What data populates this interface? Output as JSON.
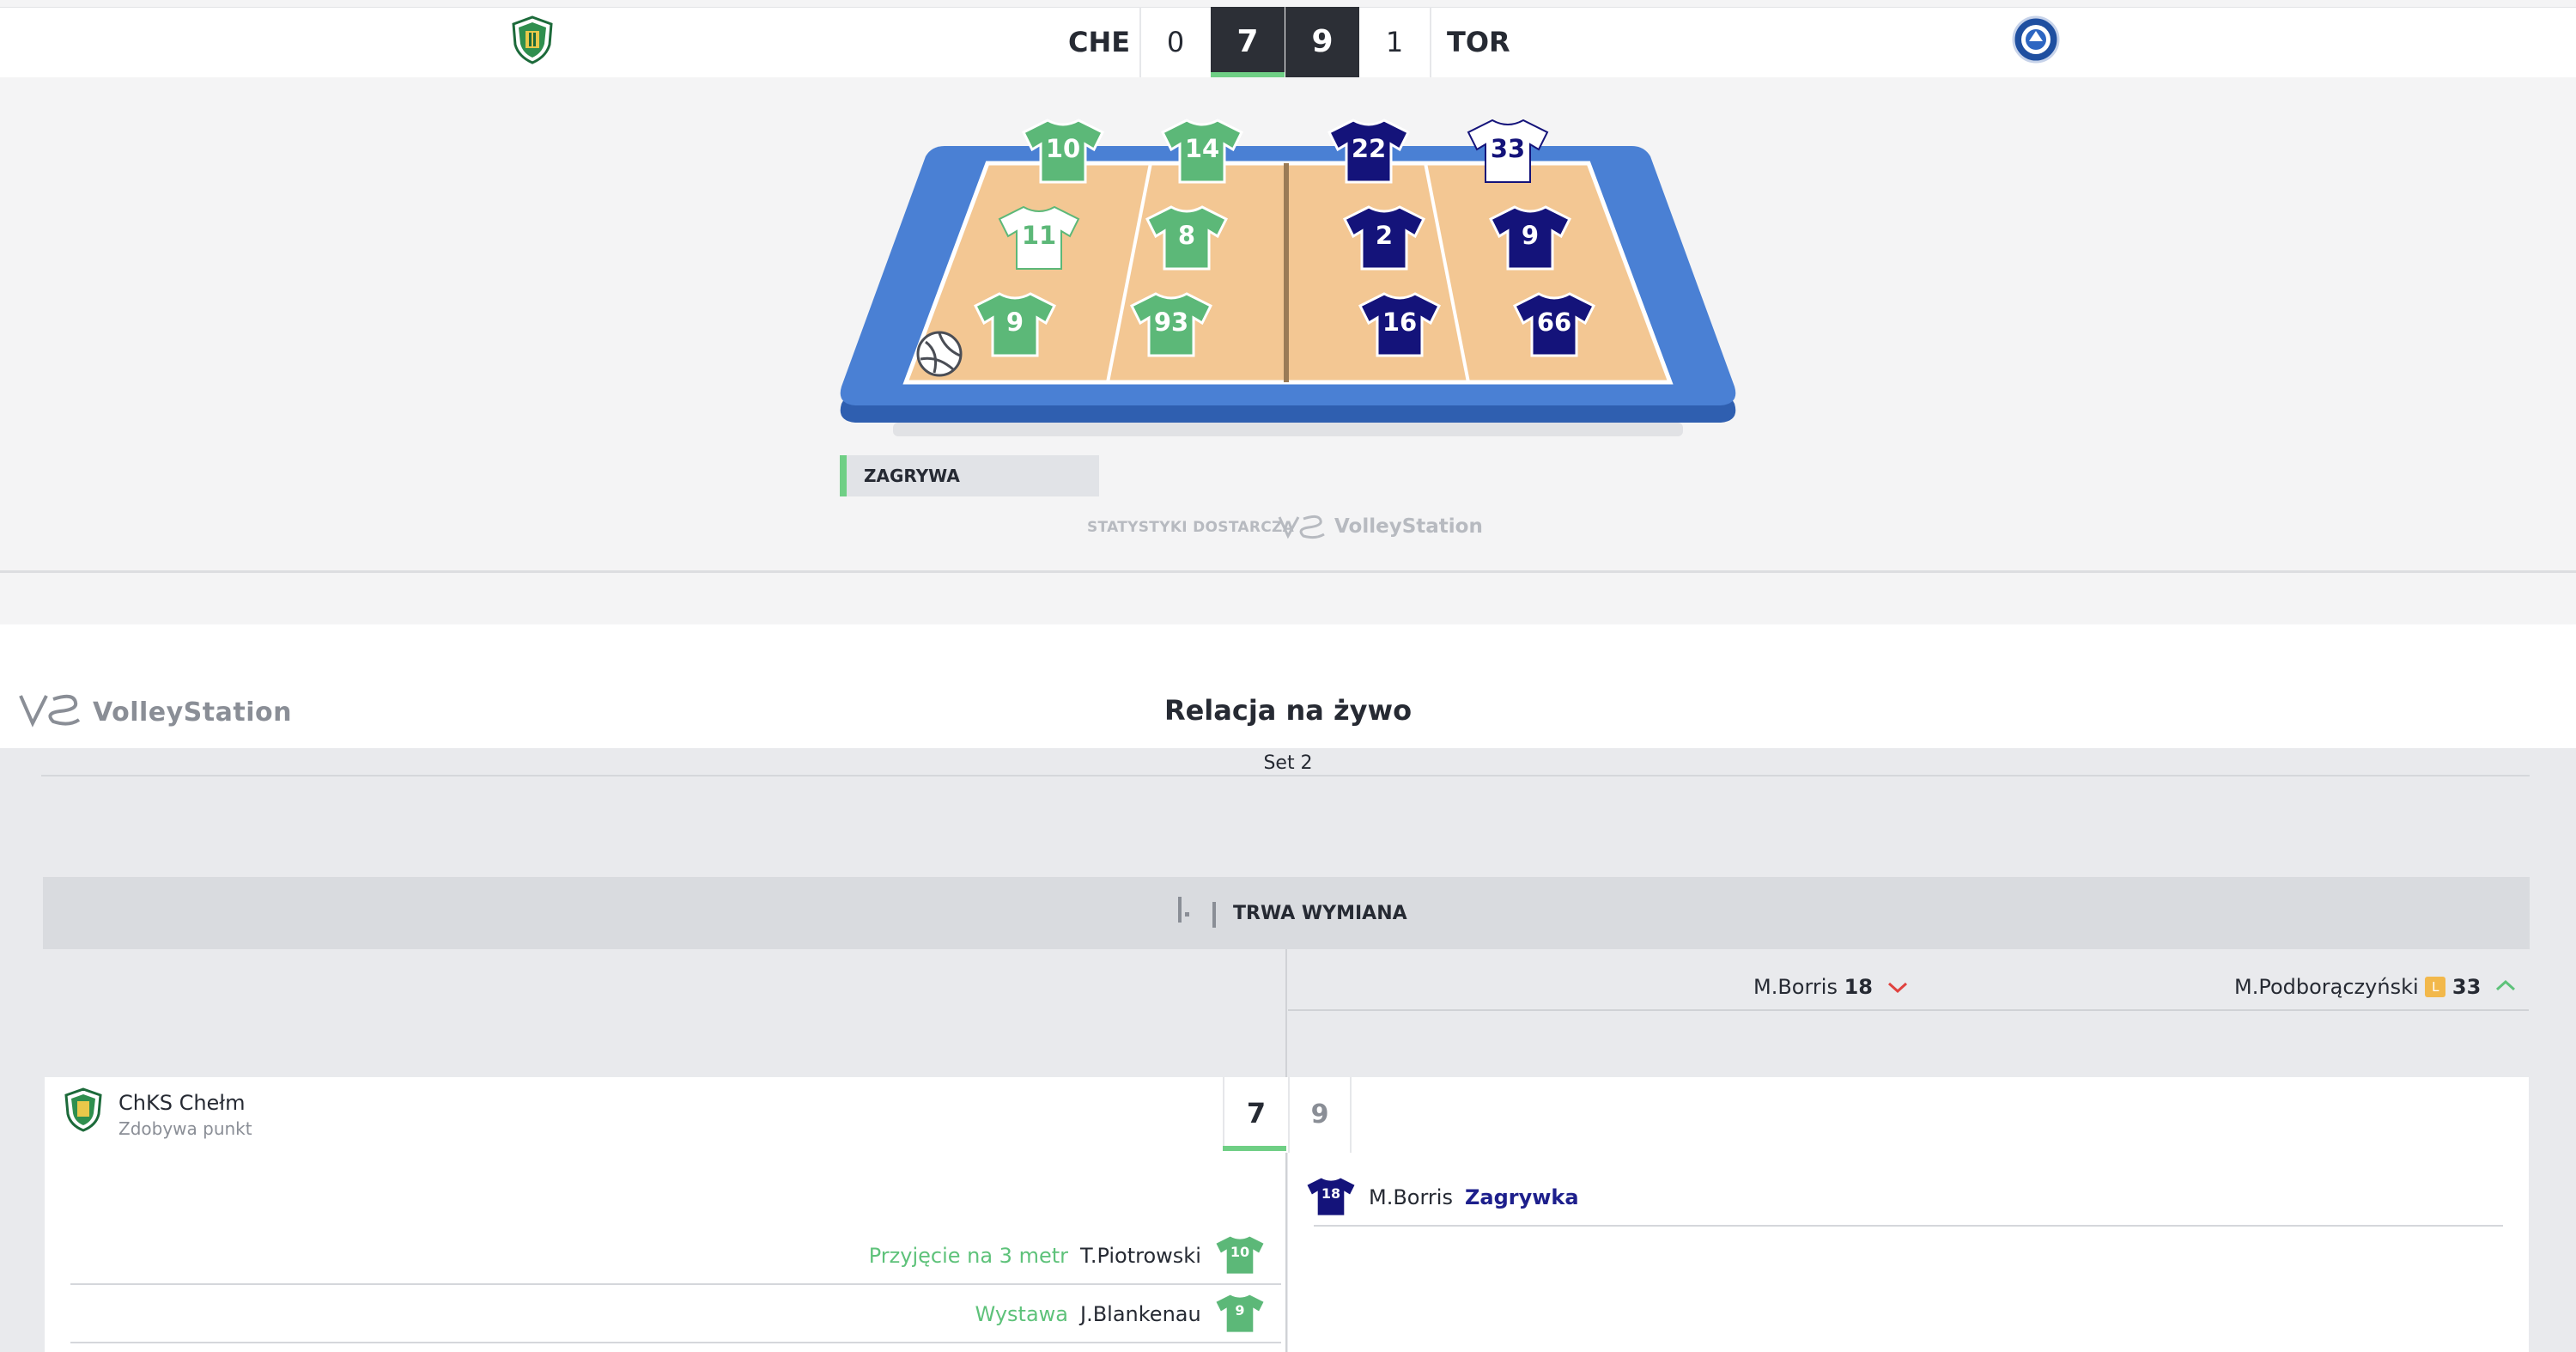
{
  "scoreboard": {
    "home_abbr": "CHE",
    "away_abbr": "TOR",
    "home_sets": "0",
    "away_sets": "1",
    "home_points": "7",
    "away_points": "9"
  },
  "court": {
    "home_players": [
      "10",
      "14",
      "11",
      "8",
      "9",
      "93"
    ],
    "away_players": [
      "22",
      "33",
      "2",
      "9",
      "16",
      "66"
    ],
    "status_tag": "ZAGRYWA",
    "powered_by_label": "STATYSTYKI DOSTARCZA",
    "powered_by_brand": "VolleyStation"
  },
  "relation": {
    "brand": "VolleyStation",
    "title": "Relacja na żywo",
    "set_label": "Set 2",
    "rally_status": "TRWA WYMIANA",
    "substitution": {
      "out_player": "M.Borris",
      "out_number": "18",
      "in_player": "M.Podborączyński",
      "in_badge": "L",
      "in_number": "33"
    },
    "score_row": {
      "club_name": "ChKS Chełm",
      "club_sub": "Zdobywa punkt",
      "home_score": "7",
      "away_score": "9"
    },
    "events_right": [
      {
        "player": "M.Borris",
        "action": "Zagrywka",
        "number": "18"
      }
    ],
    "events_left": [
      {
        "action": "Przyjęcie na 3 metr",
        "player": "T.Piotrowski",
        "number": "10"
      },
      {
        "action": "Wystawa",
        "player": "J.Blankenau",
        "number": "9"
      }
    ]
  },
  "colors": {
    "home_jersey": "#5cb878",
    "away_jersey": "#14137a",
    "libero_jersey": "#ffffff",
    "accent_green": "#6fcf85",
    "court_floor": "#f3c793",
    "court_outer": "#3f73c6"
  }
}
